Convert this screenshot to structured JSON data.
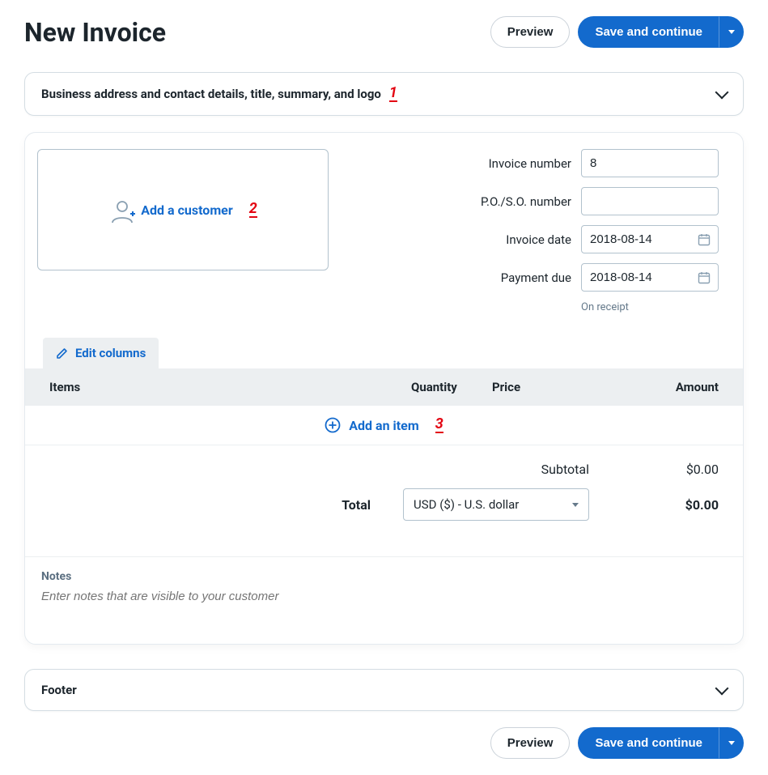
{
  "header": {
    "title": "New Invoice",
    "preview_btn": "Preview",
    "save_btn": "Save and continue"
  },
  "business_panel": {
    "label": "Business address and contact details, title, summary, and logo"
  },
  "annotations": {
    "a1": "1",
    "a2": "2",
    "a3": "3"
  },
  "customer": {
    "add_label": "Add a customer"
  },
  "fields": {
    "invoice_number_label": "Invoice number",
    "invoice_number_value": "8",
    "poso_label": "P.O./S.O. number",
    "poso_value": "",
    "invoice_date_label": "Invoice date",
    "invoice_date_value": "2018-08-14",
    "payment_due_label": "Payment due",
    "payment_due_value": "2018-08-14",
    "payment_due_hint": "On receipt"
  },
  "table": {
    "edit_columns_label": "Edit columns",
    "col_items": "Items",
    "col_quantity": "Quantity",
    "col_price": "Price",
    "col_amount": "Amount",
    "add_item_label": "Add an item"
  },
  "totals": {
    "subtotal_label": "Subtotal",
    "subtotal_value": "$0.00",
    "total_label": "Total",
    "currency_value": "USD ($) - U.S. dollar",
    "total_value": "$0.00"
  },
  "notes": {
    "label": "Notes",
    "placeholder": "Enter notes that are visible to your customer"
  },
  "footer_panel": {
    "label": "Footer"
  },
  "footer_buttons": {
    "preview": "Preview",
    "save": "Save and continue"
  }
}
